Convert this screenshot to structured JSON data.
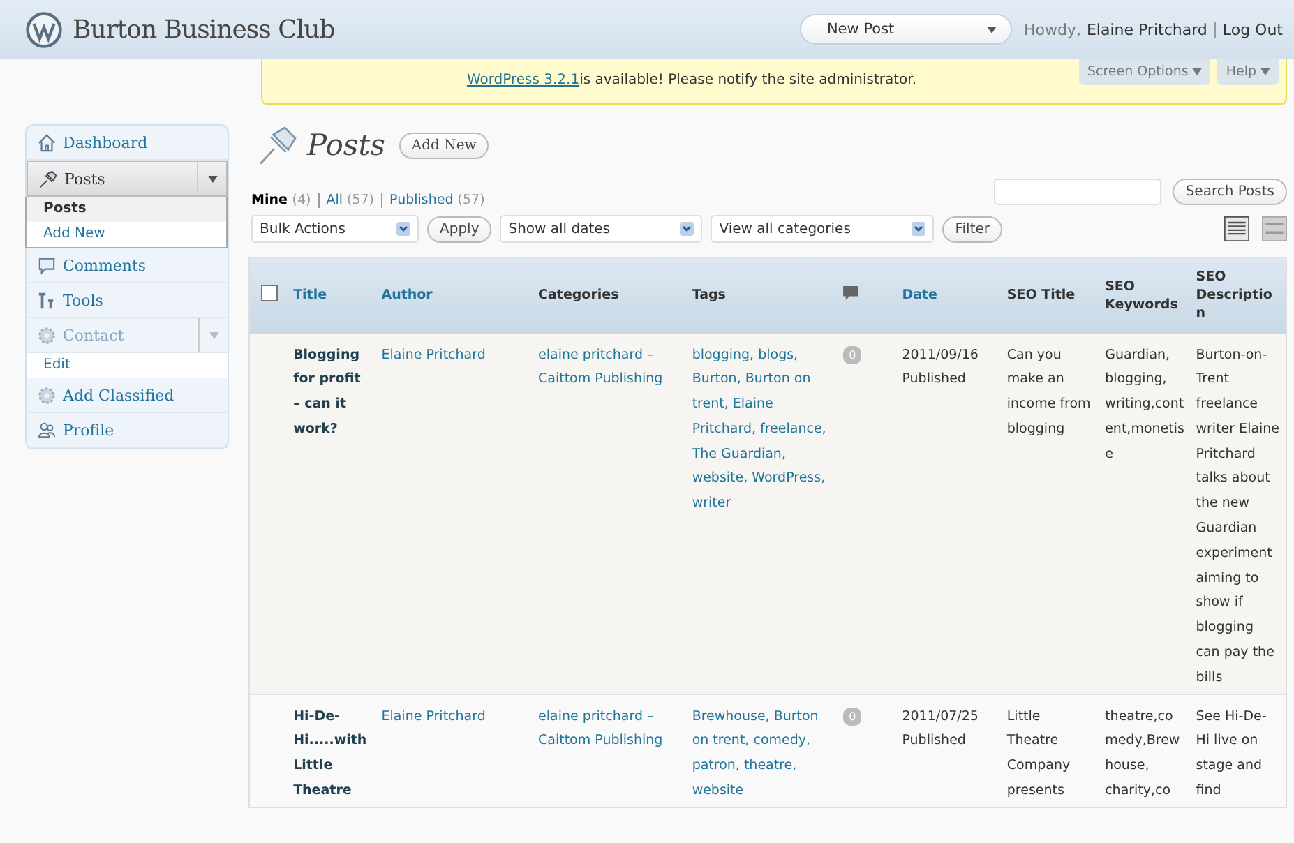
{
  "header": {
    "site_title": "Burton Business Club",
    "new_post": "New Post",
    "howdy": "Howdy,",
    "user": "Elaine Pritchard",
    "logout": "Log Out"
  },
  "notice": {
    "link": "WordPress 3.2.1",
    "text": "is available! Please notify the site administrator."
  },
  "screen_tabs": [
    "Screen Options",
    "Help"
  ],
  "sidebar": {
    "items": [
      {
        "label": "Dashboard",
        "expanded": false
      },
      {
        "label": "Posts",
        "expanded": true,
        "children": [
          {
            "label": "Posts",
            "selected": true
          },
          {
            "label": "Add New",
            "selected": false
          }
        ]
      },
      {
        "label": "Comments",
        "expanded": false
      },
      {
        "label": "Tools",
        "expanded": false
      },
      {
        "label": "Contact",
        "expanded": true,
        "children": [
          {
            "label": "Edit",
            "selected": false
          }
        ]
      },
      {
        "label": "Add Classified",
        "expanded": false
      },
      {
        "label": "Profile",
        "expanded": false
      }
    ]
  },
  "page": {
    "title": "Posts",
    "add_new": "Add New"
  },
  "filters": [
    {
      "label": "Mine",
      "count": "(4)",
      "selected": true
    },
    {
      "label": "All",
      "count": "(57)",
      "selected": false
    },
    {
      "label": "Published",
      "count": "(57)",
      "selected": false
    }
  ],
  "search": {
    "button": "Search Posts"
  },
  "tablenav": {
    "bulk": "Bulk Actions",
    "apply": "Apply",
    "dates": "Show all dates",
    "categories": "View all categories",
    "filter": "Filter"
  },
  "view_modes": [
    {
      "selected": true
    },
    {
      "selected": false
    }
  ],
  "table": {
    "select_all": {
      "checked": false
    },
    "columns": [
      {
        "label": "Title",
        "kind": "link"
      },
      {
        "label": "Author",
        "kind": "link"
      },
      {
        "label": "Categories",
        "kind": "text"
      },
      {
        "label": "Tags",
        "kind": "text"
      },
      {
        "kind": "comments"
      },
      {
        "label": "Date",
        "kind": "link"
      },
      {
        "label": "SEO Title",
        "kind": "text"
      },
      {
        "label": "SEO Keywords",
        "kind": "text"
      },
      {
        "label": "SEO Description",
        "kind": "text"
      }
    ],
    "rows": [
      {
        "title": "Blogging for profit – can it work?",
        "author": "Elaine Pritchard",
        "categories": "elaine pritchard – Caittom Publishing",
        "tags": "blogging, blogs, Burton, Burton on trent, Elaine Pritchard, freelance, The Guardian, website, WordPress, writer",
        "comments": "0",
        "date": "2011/09/16",
        "status": "Published",
        "seo_title": "Can you make an income from blogging",
        "seo_keywords": "Guardian, blogging, writing,content,monetise",
        "seo_description": "Burton-on-Trent freelance writer Elaine Pritchard talks about the new Guardian experiment aiming to show if blogging can pay the bills"
      },
      {
        "title": "Hi-De-Hi.....with Little Theatre",
        "author": "Elaine Pritchard",
        "categories": "elaine pritchard – Caittom Publishing",
        "tags": "Brewhouse, Burton on trent, comedy, patron, theatre, website",
        "comments": "0",
        "date": "2011/07/25",
        "status": "Published",
        "seo_title": "Little Theatre Company presents",
        "seo_keywords": "theatre,comedy,Brewhouse, charity,co",
        "seo_description": "See Hi-De-Hi live on stage and find"
      }
    ]
  }
}
